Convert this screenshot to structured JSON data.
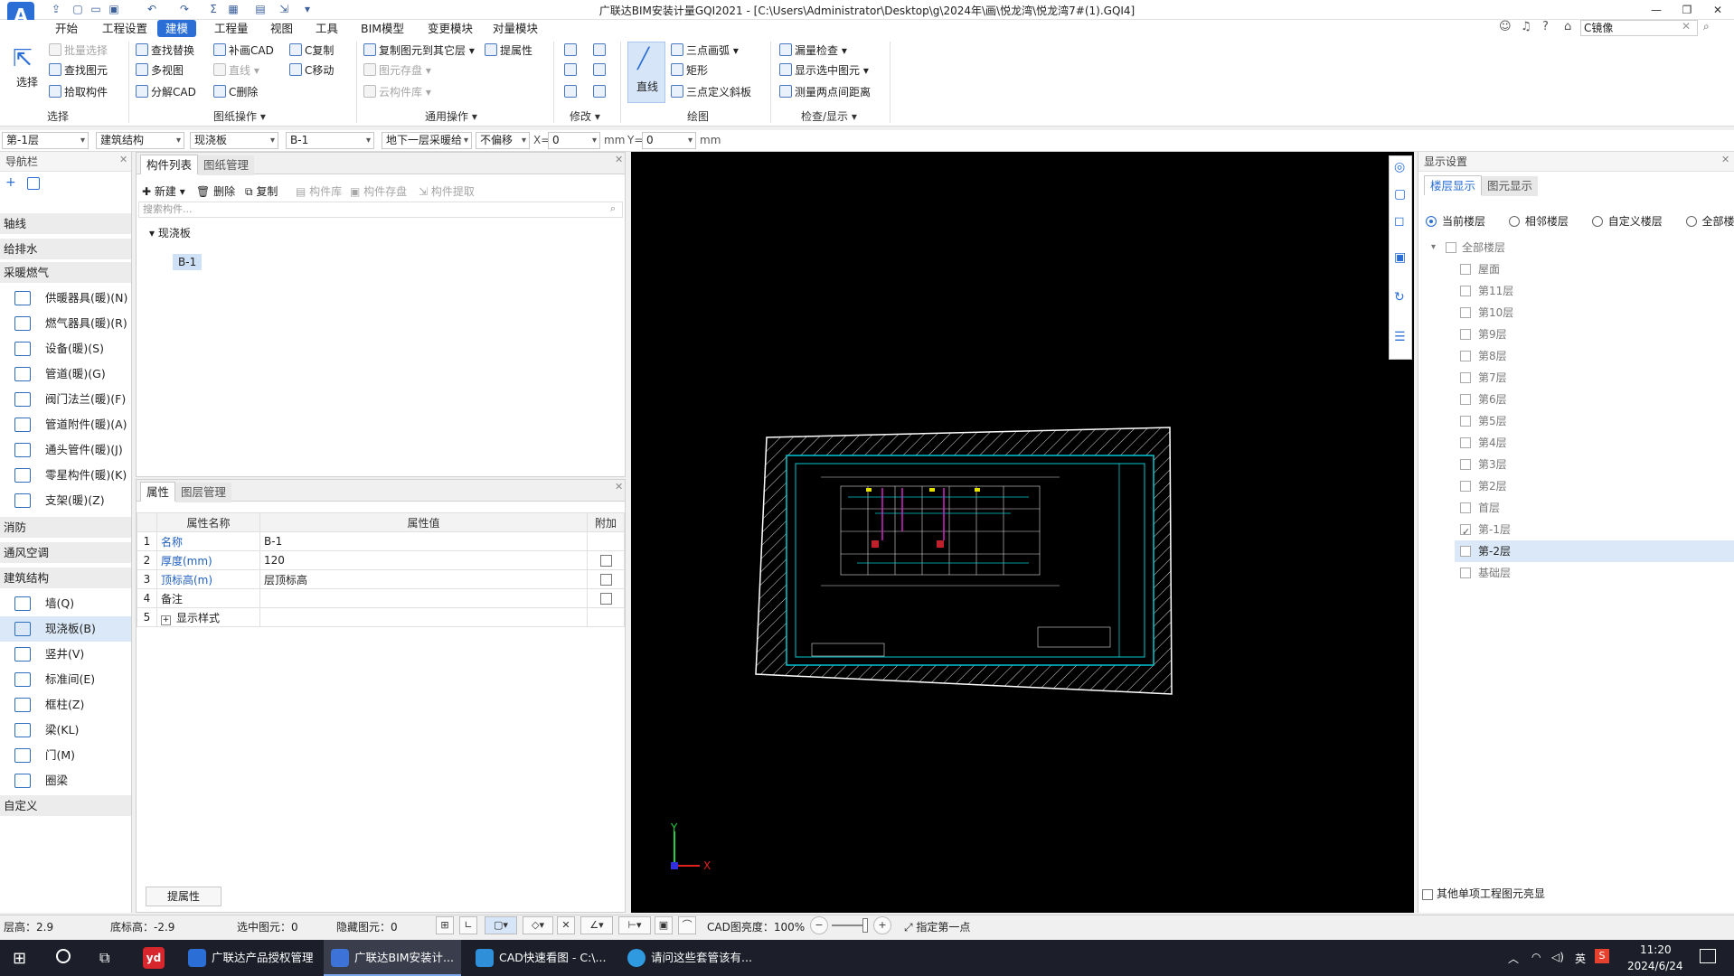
{
  "window": {
    "title": "广联达BIM安装计量GQI2021 - [C:\\Users\\Administrator\\Desktop\\g\\2024年\\画\\悦龙湾\\悦龙湾7#(1).GQI4]",
    "search_value": "C镜像"
  },
  "menu": [
    "开始",
    "工程设置",
    "建模",
    "工程量",
    "视图",
    "工具",
    "BIM模型",
    "变更模块",
    "对量模块"
  ],
  "ribbon": {
    "select": {
      "label": "选择",
      "batch": "批量选择",
      "find": "查找图元",
      "pick": "拾取构件",
      "group": "选择"
    },
    "drawing": {
      "find_replace": "查找替换",
      "multi_view": "多视图",
      "explode_cad": "分解CAD",
      "patch_cad": "补画CAD",
      "line": "直线",
      "c_delete": "C删除",
      "c_copy": "C复制",
      "c_move": "C移动",
      "group": "图纸操作"
    },
    "common": {
      "copy_to_floor": "复制图元到其它层",
      "extract_attr": "提属性",
      "elem_save": "图元存盘",
      "cloud_lib": "云构件库",
      "group": "通用操作"
    },
    "modify": {
      "group": "修改"
    },
    "draw": {
      "line_btn": "直线",
      "arc3": "三点画弧",
      "rect": "矩形",
      "slope3": "三点定义斜板",
      "group": "绘图"
    },
    "check": {
      "leak": "漏量检查",
      "show_selected": "显示选中图元",
      "measure": "测量两点间距离",
      "group": "检查/显示"
    }
  },
  "filters": {
    "floor": "第-1层",
    "category": "建筑结构",
    "type": "现浇板",
    "item": "B-1",
    "layer": "地下一层采暖给",
    "offset": "不偏移",
    "x_label": "X=",
    "x": "0",
    "y_label": "Y=",
    "y": "0",
    "unit": "mm"
  },
  "nav": {
    "title": "导航栏",
    "categories": {
      "axis": "轴线",
      "water": "给排水",
      "heating": "采暖燃气",
      "fire": "消防",
      "hvac": "通风空调",
      "arch": "建筑结构",
      "custom": "自定义"
    },
    "heating_items": [
      "供暖器具(暖)(N)",
      "燃气器具(暖)(R)",
      "设备(暖)(S)",
      "管道(暖)(G)",
      "阀门法兰(暖)(F)",
      "管道附件(暖)(A)",
      "通头管件(暖)(J)",
      "零星构件(暖)(K)",
      "支架(暖)(Z)"
    ],
    "arch_items": [
      "墙(Q)",
      "现浇板(B)",
      "竖井(V)",
      "标准间(E)",
      "框柱(Z)",
      "梁(KL)",
      "门(M)",
      "圈梁"
    ]
  },
  "components": {
    "tabs": [
      "构件列表",
      "图纸管理"
    ],
    "toolbar": {
      "new": "新建",
      "delete": "删除",
      "copy": "复制",
      "lib": "构件库",
      "save": "构件存盘",
      "extract": "构件提取"
    },
    "search_placeholder": "搜索构件...",
    "tree_root": "现浇板",
    "tree_item": "B-1"
  },
  "properties": {
    "tabs": [
      "属性",
      "图层管理"
    ],
    "headers": [
      "属性名称",
      "属性值",
      "附加"
    ],
    "rows": [
      {
        "no": "1",
        "name": "名称",
        "value": "B-1"
      },
      {
        "no": "2",
        "name": "厚度(mm)",
        "value": "120"
      },
      {
        "no": "3",
        "name": "顶标高(m)",
        "value": "层顶标高"
      },
      {
        "no": "4",
        "name": "备注",
        "value": ""
      },
      {
        "no": "5",
        "name": "显示样式",
        "value": ""
      }
    ],
    "button": "提属性"
  },
  "display": {
    "title": "显示设置",
    "tabs": [
      "楼层显示",
      "图元显示"
    ],
    "radios": [
      "当前楼层",
      "相邻楼层",
      "自定义楼层",
      "全部楼层"
    ],
    "root": "全部楼层",
    "floors": [
      "屋面",
      "第11层",
      "第10层",
      "第9层",
      "第8层",
      "第7层",
      "第6层",
      "第5层",
      "第4层",
      "第3层",
      "第2层",
      "首层",
      "第-1层",
      "第-2层",
      "基础层"
    ],
    "bottom_check": "其他单项工程图元亮显"
  },
  "status": {
    "floor_h": "层高：2.9",
    "base_h": "底标高：-2.9",
    "selected": "选中图元：0",
    "hidden": "隐藏图元：0",
    "cad_brightness": "CAD图亮度：100%",
    "hint": "指定第一点"
  },
  "taskbar": {
    "items": [
      "广联达产品授权管理",
      "广联达BIM安装计...",
      "CAD快速看图 - C:\\...",
      "请问这些套管该有..."
    ],
    "ime": "英",
    "time": "11:20",
    "date": "2024/6/24"
  },
  "colors": {
    "accent": "#2b6fd6",
    "canvas": "#000000",
    "cad_cyan": "#00c8d2",
    "cad_white": "#ffffff"
  }
}
